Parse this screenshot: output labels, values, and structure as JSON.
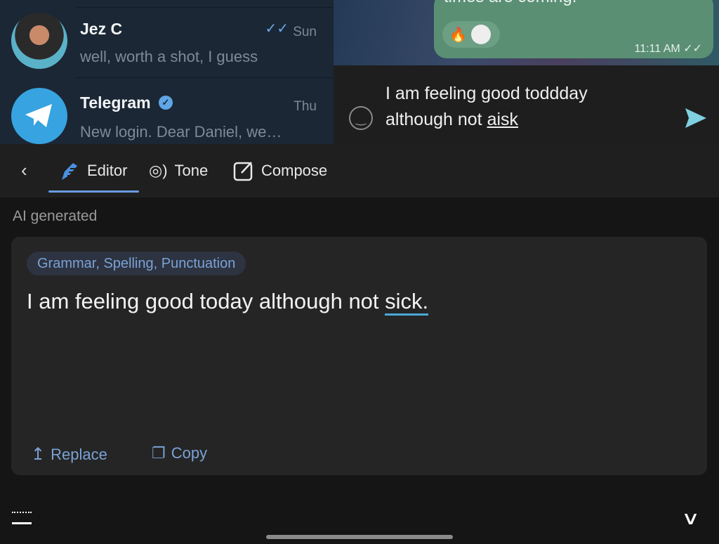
{
  "chats": [
    {
      "name": "Jez C",
      "date": "Sun",
      "preview": "well, worth a shot, I guess",
      "read": true
    },
    {
      "name": "Telegram",
      "date": "Thu",
      "preview": "New login. Dear Daniel, we…",
      "verified": true
    }
  ],
  "message": {
    "text": "times are coming.",
    "time": "11:11 AM",
    "reactions": [
      "🔥"
    ]
  },
  "composer": {
    "line1": "I am feeling good toddday",
    "line2_prefix": "although not ",
    "line2_error": "aisk"
  },
  "toolbar": {
    "tabs": [
      {
        "label": "Editor",
        "active": true
      },
      {
        "label": "Tone"
      },
      {
        "label": "Compose"
      }
    ]
  },
  "section_label": "AI generated",
  "suggestion": {
    "tag": "Grammar, Spelling, Punctuation",
    "text_prefix": "I am feeling good today although not ",
    "text_fix": "sick.",
    "replace_label": "Replace",
    "copy_label": "Copy"
  },
  "colors": {
    "accent": "#7aa2d6",
    "bubble": "#5a8f74",
    "send": "#7fd0e0"
  }
}
